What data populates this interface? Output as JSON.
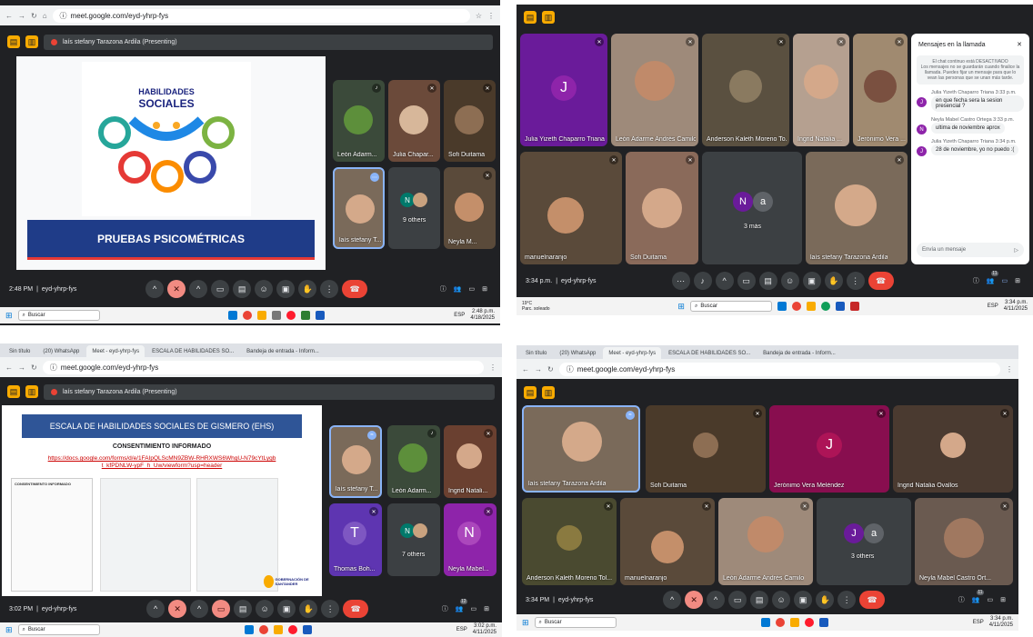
{
  "p1": {
    "url": "meet.google.com/eyd-yhrp-fys",
    "presenting": "laís stefany Tarazona Ardila (Presenting)",
    "slide": {
      "title": "HABILIDADES",
      "subtitle": "SOCIALES",
      "banner": "PRUEBAS PSICOMÉTRICAS"
    },
    "tiles": [
      {
        "name": "León Adarm..."
      },
      {
        "name": "Julia Chapar..."
      },
      {
        "name": "Sofi Duitama"
      },
      {
        "name": "laís stefany T..."
      },
      {
        "name": "9 others"
      },
      {
        "name": "Neyla M..."
      }
    ],
    "time": "2:48 PM",
    "code": "eyd-yhrp-fys",
    "search": "Buscar",
    "lang": "ESP",
    "clock": "2:48 p.m.",
    "date": "4/18/2025"
  },
  "p2": {
    "tiles": [
      {
        "name": "Julia Yizeth Chaparro Triana",
        "initial": "J"
      },
      {
        "name": "León Adarme Andrés Camilo"
      },
      {
        "name": "Anderson Kaleth Moreno To..."
      },
      {
        "name": "Ingrid Natalia ..."
      },
      {
        "name": "Jerónimo Vera ..."
      },
      {
        "name": "manuelnaranjo"
      },
      {
        "name": "Sofi Duitama"
      },
      {
        "name": "3 más",
        "i1": "N",
        "i2": "a"
      },
      {
        "name": "laís stefany Tarazona Ardila"
      }
    ],
    "chat": {
      "title": "Mensajes en la llamada",
      "notice_title": "El chat continuo está DESACTIVADO",
      "notice": "Los mensajes no se guardarán cuando finalice la llamada. Puedes fijar un mensaje para que lo vean las personas que se unan más tarde.",
      "messages": [
        {
          "author": "Julia Yizeth Chaparro Triana",
          "time": "3:33 p.m.",
          "text": "en que fecha sera la sesion presencial ?",
          "initial": "J"
        },
        {
          "author": "Neyla Mabel Castro Ortega",
          "time": "3:33 p.m.",
          "text": "ultima de noviembre aprox",
          "initial": "N"
        },
        {
          "author": "Julia Yizeth Chaparro Triana",
          "time": "3:34 p.m.",
          "text": "28 de noviembre, yo no puedo :(",
          "initial": "J"
        }
      ],
      "placeholder": "Envía un mensaje"
    },
    "time": "3:34 p.m.",
    "code": "eyd-yhrp-fys",
    "count": "11",
    "weather": "19°C",
    "weather2": "Parc. soleado",
    "search": "Buscar",
    "lang": "ESP",
    "clock": "3:34 p.m.",
    "date": "4/11/2025"
  },
  "p3": {
    "tabs": [
      "Sin título",
      "(20) WhatsApp",
      "Meet - eyd-yhrp-fys",
      "ESCALA DE HABILIDADES SO...",
      "Bandeja de entrada - Inform..."
    ],
    "url": "meet.google.com/eyd-yhrp-fys",
    "presenting": "laís stefany Tarazona Ardila (Presenting)",
    "slide": {
      "title": "ESCALA DE HABILIDADES SOCIALES DE GISMERO (EHS)",
      "subtitle": "CONSENTIMIENTO INFORMADO",
      "link": "https://docs.google.com/forms/d/e/1FAIpQLScMN9ZBW-RHRXWS6WhgU-N79cYtLygbt_kfPDNLW-ypF_h_Uw/viewform?usp=header",
      "doc_head": "CONSENTIMIENTO INFORMADO",
      "logo": "GOBERNACIÓN DE SANTANDER"
    },
    "tiles": [
      {
        "name": "laís stefany T..."
      },
      {
        "name": "León Adarm..."
      },
      {
        "name": "Ingrid Natali..."
      },
      {
        "name": "Thomas Boh...",
        "initial": "T"
      },
      {
        "name": "7 others",
        "initial": "N"
      },
      {
        "name": "Neyla Mabel...",
        "initial": "N"
      }
    ],
    "time": "3:02 PM",
    "code": "eyd-yhrp-fys",
    "count": "12",
    "search": "Buscar",
    "lang": "ESP",
    "clock": "3:02 p.m.",
    "date": "4/11/2025"
  },
  "p4": {
    "tabs": [
      "Sin título",
      "(20) WhatsApp",
      "Meet - eyd-yhrp-fys",
      "ESCALA DE HABILIDADES SO...",
      "Bandeja de entrada - Inform..."
    ],
    "url": "meet.google.com/eyd-yhrp-fys",
    "tiles": [
      {
        "name": "laís stefany Tarazona Ardila"
      },
      {
        "name": "Sofi Duitama"
      },
      {
        "name": "Jerónimo Vera Meléndez",
        "initial": "J"
      },
      {
        "name": "Ingrid Natalia Ovallos"
      },
      {
        "name": "Anderson Kaleth Moreno Tol..."
      },
      {
        "name": "manuelnaranjo"
      },
      {
        "name": "León Adarme Andrés Camilo"
      },
      {
        "name": "3 others",
        "i1": "J",
        "i2": "a"
      },
      {
        "name": "Neyla Mabel Castro Ort..."
      }
    ],
    "time": "3:34 PM",
    "code": "eyd-yhrp-fys",
    "count": "11",
    "search": "Buscar",
    "lang": "ESP",
    "clock": "3:34 p.m.",
    "date": "4/11/2025"
  }
}
